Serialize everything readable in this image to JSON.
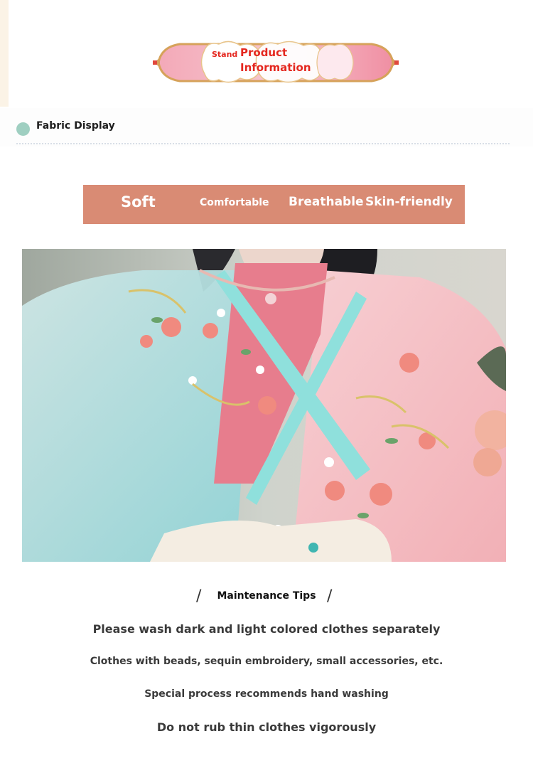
{
  "banner": {
    "small": "Stand",
    "line1": "Product",
    "line2": "Information"
  },
  "section": {
    "title": "Fabric Display"
  },
  "features": [
    "Soft",
    "Comfortable",
    "Breathable",
    "Skin-friendly"
  ],
  "photo": {
    "icon": "hanfu-embroidered-fabric-photo"
  },
  "maintenance": {
    "title": "Maintenance Tips",
    "tips": [
      "Please wash dark and light colored clothes separately",
      "Clothes with beads, sequin embroidery, small accessories, etc.",
      "Special process recommends hand washing",
      "Do not rub thin clothes vigorously"
    ]
  },
  "colors": {
    "accent_red": "#e4271f",
    "feature_bar": "#d98b74",
    "dot": "#9fcfc1"
  }
}
